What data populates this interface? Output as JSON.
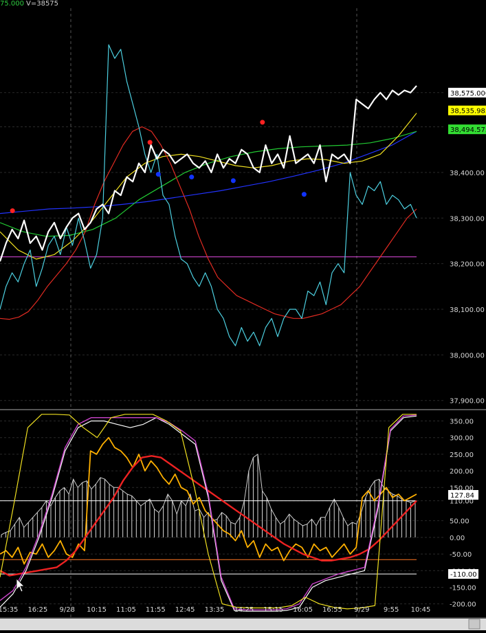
{
  "header": {
    "price_fragment": "75.000",
    "volume_label": "V=38575",
    "price_color": "#2ecc40",
    "volume_color": "#cfcfcf"
  },
  "chart_data": [
    {
      "type": "line",
      "title": "",
      "ylim": [
        37880,
        38760
      ],
      "grid": "dashed-dark",
      "yticks": [
        37900,
        38000,
        38100,
        38200,
        38300,
        38400,
        38500,
        38575
      ],
      "ytick_labels": [
        "37,900.00",
        "38,000.00",
        "38,100.00",
        "38,200.00",
        "38,300.00",
        "38,400.00",
        "38,500.00",
        "38,575.000"
      ],
      "badges": [
        {
          "label": "38,575.000",
          "value": 38575.0,
          "bg": "#ffffff"
        },
        {
          "label": "38,535.983",
          "value": 38535.983,
          "bg": "#ffff00"
        },
        {
          "label": "38,494.575",
          "value": 38494.575,
          "bg": "#33dd33"
        }
      ],
      "hline": {
        "value": 38215,
        "color": "#cc44cc"
      },
      "series": [
        {
          "color": "#ffffff",
          "width": 2.2,
          "values": [
            38205,
            38245,
            38275,
            38255,
            38295,
            38245,
            38260,
            38230,
            38270,
            38290,
            38255,
            38280,
            38300,
            38310,
            38275,
            38290,
            38320,
            38330,
            38310,
            38360,
            38350,
            38390,
            38380,
            38420,
            38400,
            38460,
            38430,
            38450,
            38440,
            38420,
            38430,
            38440,
            38420,
            38410,
            38425,
            38400,
            38440,
            38410,
            38430,
            38420,
            38450,
            38440,
            38410,
            38400,
            38460,
            38420,
            38440,
            38410,
            38480,
            38420,
            38430,
            38440,
            38420,
            38460,
            38380,
            38440,
            38430,
            38440,
            38420,
            38560,
            38550,
            38540,
            38560,
            38575,
            38560,
            38580,
            38570,
            38580,
            38575,
            38590
          ]
        },
        {
          "color": "#4dd0e1",
          "width": 1.2,
          "values": [
            38100,
            38150,
            38180,
            38160,
            38200,
            38230,
            38150,
            38190,
            38240,
            38260,
            38220,
            38280,
            38240,
            38300,
            38250,
            38190,
            38220,
            38300,
            38680,
            38650,
            38670,
            38600,
            38550,
            38500,
            38440,
            38400,
            38440,
            38350,
            38330,
            38260,
            38210,
            38200,
            38170,
            38150,
            38180,
            38150,
            38100,
            38080,
            38040,
            38020,
            38060,
            38030,
            38050,
            38020,
            38060,
            38080,
            38040,
            38080,
            38100,
            38100,
            38080,
            38140,
            38130,
            38160,
            38110,
            38180,
            38200,
            38180,
            38400,
            38350,
            38330,
            38370,
            38360,
            38380,
            38330,
            38350,
            38340,
            38320,
            38330,
            38300
          ]
        },
        {
          "color": "#e22b22",
          "width": 1.2,
          "values": [
            38080,
            38078,
            38083,
            38095,
            38120,
            38150,
            38175,
            38200,
            38230,
            38270,
            38330,
            38380,
            38420,
            38460,
            38490,
            38500,
            38490,
            38460,
            38420,
            38370,
            38320,
            38260,
            38210,
            38170,
            38150,
            38130,
            38120,
            38110,
            38100,
            38090,
            38085,
            38080,
            38080,
            38085,
            38090,
            38100,
            38110,
            38130,
            38150,
            38180,
            38210,
            38240,
            38270,
            38300,
            38320
          ]
        },
        {
          "color": "#f0e020",
          "width": 1.2,
          "values": [
            38270,
            38230,
            38210,
            38220,
            38250,
            38290,
            38340,
            38390,
            38420,
            38435,
            38440,
            38435,
            38425,
            38415,
            38410,
            38415,
            38425,
            38430,
            38428,
            38420,
            38425,
            38440,
            38480,
            38530
          ]
        },
        {
          "color": "#22cc33",
          "width": 1.2,
          "values": [
            38290,
            38270,
            38260,
            38262,
            38275,
            38300,
            38340,
            38370,
            38400,
            38420,
            38435,
            38445,
            38452,
            38456,
            38458,
            38460,
            38465,
            38475,
            38490
          ]
        },
        {
          "color": "#2233ff",
          "width": 1.2,
          "values": [
            38310,
            38315,
            38320,
            38322,
            38325,
            38330,
            38336,
            38344,
            38352,
            38360,
            38370,
            38380,
            38392,
            38405,
            38420,
            38440,
            38460,
            38490
          ]
        }
      ],
      "dots": [
        {
          "color": "#ff2222",
          "x": 0.03,
          "value": 38316
        },
        {
          "color": "#ff2222",
          "x": 0.36,
          "value": 38466
        },
        {
          "color": "#ff2222",
          "x": 0.63,
          "value": 38510
        },
        {
          "color": "#1133ff",
          "x": 0.38,
          "value": 38396
        },
        {
          "color": "#1133ff",
          "x": 0.46,
          "value": 38390
        },
        {
          "color": "#1133ff",
          "x": 0.56,
          "value": 38382
        },
        {
          "color": "#1133ff",
          "x": 0.73,
          "value": 38352
        }
      ]
    },
    {
      "type": "line",
      "title": "",
      "ylim": [
        -240,
        380
      ],
      "yticks": [
        350,
        300,
        250,
        200,
        150,
        110,
        50,
        0,
        -50,
        -100,
        -150,
        -200
      ],
      "ytick_labels": [
        "350.00",
        "300.00",
        "250.00",
        "200.00",
        "150.00",
        "110.00",
        "50.00",
        "0.00",
        "-50.00",
        "-100.00",
        "-150.00",
        "-200.00"
      ],
      "badges": [
        {
          "label": "127.84",
          "value": 127.84,
          "bg": "#ffffff"
        },
        {
          "label": "-110.00",
          "value": -110.0,
          "bg": "#ffffff"
        }
      ],
      "hlines": [
        {
          "value": 110,
          "color": "#ffffff"
        },
        {
          "value": -110,
          "color": "#ffffff"
        },
        {
          "value": -67,
          "color": "#ff7722"
        }
      ],
      "histogram": {
        "color": "#ffffff",
        "values": [
          8,
          15,
          20,
          40,
          60,
          30,
          45,
          60,
          75,
          90,
          110,
          95,
          120,
          140,
          150,
          130,
          175,
          150,
          165,
          170,
          145,
          160,
          180,
          175,
          160,
          150,
          150,
          140,
          130,
          125,
          110,
          95,
          105,
          115,
          85,
          75,
          95,
          130,
          110,
          70,
          110,
          95,
          130,
          80,
          85,
          60,
          75,
          50,
          55,
          75,
          65,
          45,
          40,
          60,
          110,
          200,
          240,
          250,
          140,
          120,
          85,
          60,
          40,
          50,
          70,
          55,
          45,
          35,
          40,
          55,
          35,
          60,
          60,
          90,
          115,
          90,
          60,
          35,
          45,
          40,
          75,
          120,
          150,
          170,
          175,
          150,
          140,
          130,
          125,
          115,
          110,
          105,
          110
        ]
      },
      "series": [
        {
          "color": "#ffb000",
          "width": 1.8,
          "values": [
            -50,
            -40,
            -60,
            -30,
            -80,
            -45,
            -50,
            -20,
            -60,
            -40,
            -10,
            -50,
            -60,
            -20,
            -40,
            260,
            250,
            280,
            300,
            270,
            260,
            240,
            210,
            250,
            200,
            230,
            210,
            180,
            160,
            190,
            150,
            140,
            100,
            120,
            80,
            60,
            40,
            20,
            10,
            -10,
            20,
            -30,
            -10,
            -60,
            -20,
            -40,
            -30,
            -70,
            -40,
            -20,
            -30,
            -60,
            -20,
            -40,
            -30,
            -60,
            -40,
            -20,
            -50,
            -30,
            120,
            140,
            110,
            130,
            150,
            120,
            130,
            110,
            120,
            130
          ]
        },
        {
          "color": "#ee2222",
          "width": 2.4,
          "values": [
            -100,
            -115,
            -110,
            -105,
            -100,
            -95,
            -90,
            -70,
            -40,
            0,
            40,
            80,
            120,
            170,
            210,
            240,
            245,
            240,
            220,
            200,
            180,
            160,
            140,
            120,
            100,
            80,
            60,
            40,
            20,
            0,
            -20,
            -35,
            -50,
            -60,
            -70,
            -70,
            -65,
            -60,
            -50,
            -35,
            -10,
            20,
            50,
            80,
            110
          ]
        },
        {
          "color": "#ffffff",
          "width": 1.2,
          "values": [
            -210,
            -170,
            -100,
            0,
            120,
            260,
            330,
            350,
            350,
            340,
            330,
            340,
            360,
            340,
            310,
            280,
            120,
            -130,
            -220,
            -222,
            -222,
            -222,
            -220,
            -210,
            -150,
            -130,
            -120,
            -110,
            -100,
            80,
            320,
            360,
            365
          ]
        },
        {
          "color": "#cc44cc",
          "width": 1.4,
          "values": [
            -190,
            -160,
            -90,
            10,
            130,
            270,
            340,
            360,
            360,
            360,
            360,
            360,
            360,
            345,
            320,
            290,
            130,
            -120,
            -215,
            -218,
            -218,
            -218,
            -215,
            -200,
            -140,
            -125,
            -110,
            -100,
            -90,
            90,
            325,
            365,
            368
          ]
        },
        {
          "color": "#f0e020",
          "width": 1.2,
          "values": [
            -120,
            100,
            330,
            370,
            370,
            368,
            330,
            300,
            360,
            370,
            370,
            370,
            350,
            320,
            150,
            -50,
            -200,
            -210,
            -212,
            -212,
            -212,
            -205,
            -180,
            -200,
            -210,
            -215,
            -212,
            -205,
            330,
            370,
            370
          ]
        }
      ]
    }
  ],
  "time_axis": {
    "labels": [
      "15:35",
      "16:25",
      "9/28",
      "10:15",
      "11:05",
      "11:55",
      "12:45",
      "13:35",
      "14:25",
      "15:15",
      "16:05",
      "16:55",
      "9/29",
      "9:55",
      "10:45"
    ]
  }
}
